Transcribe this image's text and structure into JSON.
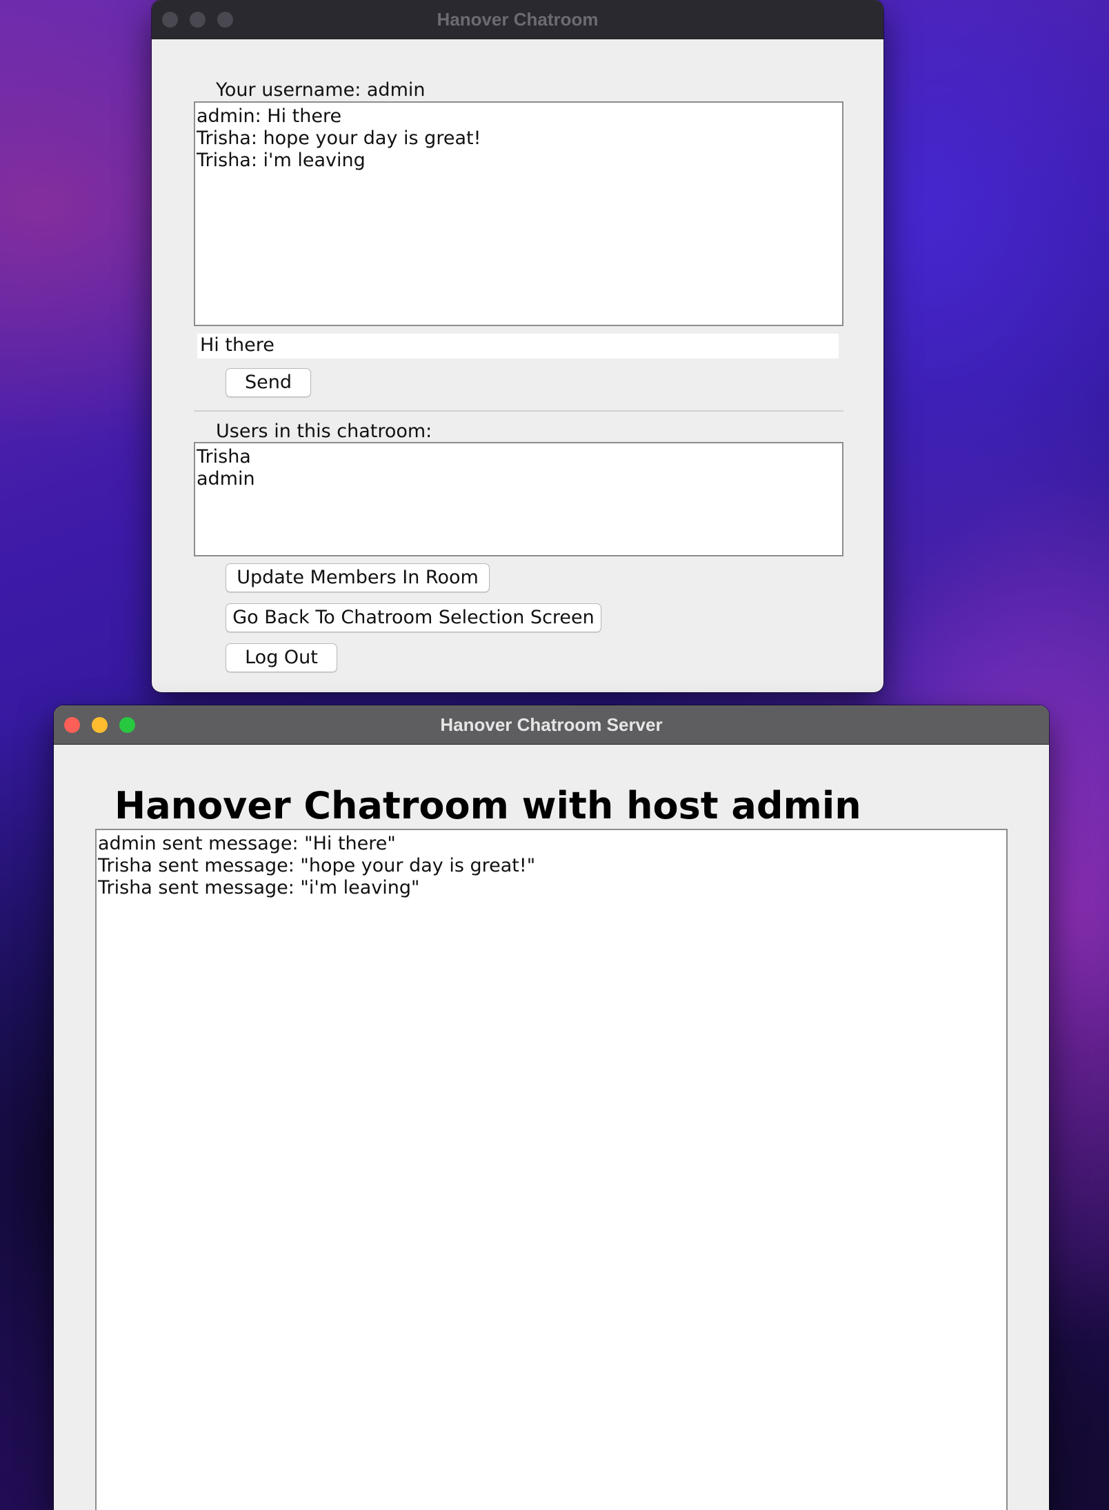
{
  "client_window": {
    "title": "Hanover Chatroom",
    "username_label": "Your username: admin",
    "messages": [
      "admin: Hi there",
      "Trisha: hope your day is great!",
      "Trisha: i'm leaving"
    ],
    "message_input_value": "Hi there",
    "send_label": "Send",
    "users_label": "Users in this chatroom:",
    "users": [
      "Trisha",
      "admin"
    ],
    "update_members_label": "Update Members In Room",
    "go_back_label": "Go Back To Chatroom Selection Screen",
    "logout_label": "Log Out"
  },
  "server_window": {
    "title": "Hanover Chatroom Server",
    "heading": "Hanover Chatroom with host admin",
    "log": [
      "admin sent message: \"Hi there\"",
      "Trisha sent message: \"hope your day is great!\"",
      "Trisha sent message: \"i'm leaving\""
    ]
  },
  "colors": {
    "close": "#fe5f57",
    "minimize": "#febc2e",
    "maximize": "#28c840",
    "inactive_light": "#4a4850"
  }
}
